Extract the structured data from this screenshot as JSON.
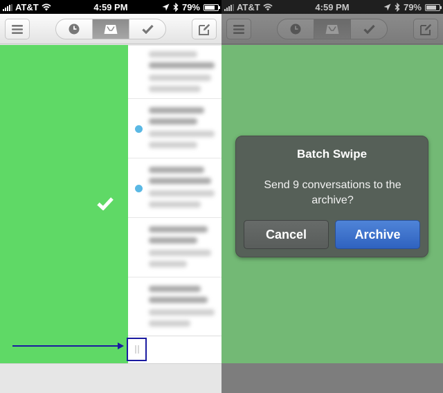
{
  "status_bar": {
    "carrier": "AT&T",
    "time": "4:59 PM",
    "battery": "79%",
    "battery_level": 0.79
  },
  "nav": {
    "menu_icon": "hamburger-menu-icon",
    "tabs": [
      {
        "icon": "clock-icon",
        "name": "later"
      },
      {
        "icon": "inbox-tray-icon",
        "name": "inbox",
        "active": true
      },
      {
        "icon": "checkmark-icon",
        "name": "archive"
      }
    ],
    "compose_icon": "compose-icon"
  },
  "swipe": {
    "color": "#5fd966",
    "action_icon": "checkmark-icon"
  },
  "dialog": {
    "title": "Batch Swipe",
    "message": "Send 9 conversations to the archive?",
    "cancel_label": "Cancel",
    "confirm_label": "Archive",
    "confirm_color": "#3a6fcc"
  }
}
